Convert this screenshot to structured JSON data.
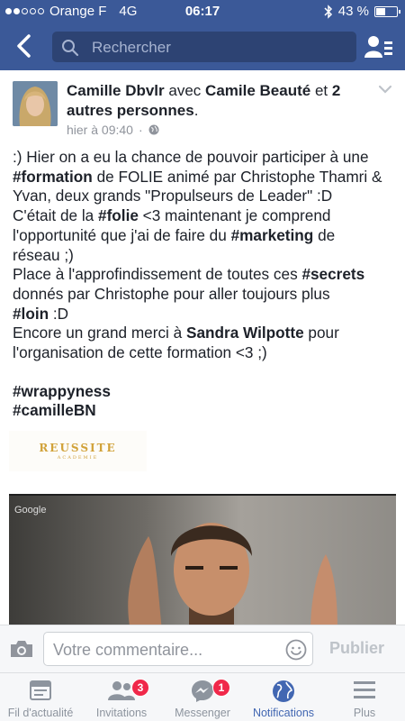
{
  "status_bar": {
    "carrier": "Orange F",
    "network": "4G",
    "time": "06:17",
    "battery": "43 %",
    "battery_level": 0.43
  },
  "navbar": {
    "search_placeholder": "Rechercher",
    "icons": [
      "back-chevron-icon",
      "search-icon",
      "friend-requests-icon"
    ]
  },
  "post": {
    "author": "Camille Dbvlr",
    "with_word": "avec",
    "tagged": "Camile Beauté",
    "and_word": "et",
    "others": "2 autres personnes",
    "period": ".",
    "timestamp": "hier à 09:40",
    "separator": "·",
    "lines": [
      {
        "parts": [
          {
            "t": ":) Hier on a eu la chance de pouvoir participer à une",
            "b": false
          }
        ]
      },
      {
        "parts": [
          {
            "t": "#formation",
            "b": true
          },
          {
            "t": " de FOLIE animé par Christophe Thamri &",
            "b": false
          }
        ]
      },
      {
        "parts": [
          {
            "t": "Yvan, deux grands \"Propulseurs de Leader\" :D",
            "b": false
          }
        ]
      },
      {
        "parts": [
          {
            "t": "C'était de la ",
            "b": false
          },
          {
            "t": "#folie",
            "b": true
          },
          {
            "t": " <3 maintenant je comprend",
            "b": false
          }
        ]
      },
      {
        "parts": [
          {
            "t": "l'opportunité que j'ai de faire du ",
            "b": false
          },
          {
            "t": "#marketing",
            "b": true
          },
          {
            "t": " de",
            "b": false
          }
        ]
      },
      {
        "parts": [
          {
            "t": "réseau ;)",
            "b": false
          }
        ]
      },
      {
        "parts": [
          {
            "t": "Place à l'approfindissement de toutes ces ",
            "b": false
          },
          {
            "t": "#secrets",
            "b": true
          }
        ]
      },
      {
        "parts": [
          {
            "t": "donnés par Christophe pour aller toujours plus",
            "b": false
          }
        ]
      },
      {
        "parts": [
          {
            "t": "#loin",
            "b": true
          },
          {
            "t": " :D",
            "b": false
          }
        ]
      },
      {
        "parts": [
          {
            "t": "Encore un grand merci à ",
            "b": false
          },
          {
            "t": "Sandra Wilpotte",
            "b": true
          },
          {
            "t": " pour",
            "b": false
          }
        ]
      },
      {
        "parts": [
          {
            "t": "l'organisation de cette formation <3 ;)",
            "b": false
          }
        ]
      }
    ],
    "hashtags": [
      "#wrappyness",
      "#camilleBN"
    ],
    "image_logo": {
      "line1": "REUSSITE",
      "line2": "ACADEMIE"
    },
    "video_label": "Google"
  },
  "comment_bar": {
    "placeholder": "Votre commentaire...",
    "publish_label": "Publier"
  },
  "tabs": [
    {
      "label": "Fil d'actualité",
      "icon": "news-feed-icon",
      "badge": null,
      "active": false
    },
    {
      "label": "Invitations",
      "icon": "friends-icon",
      "badge": "3",
      "active": false
    },
    {
      "label": "Messenger",
      "icon": "messenger-icon",
      "badge": "1",
      "active": false
    },
    {
      "label": "Notifications",
      "icon": "globe-icon",
      "badge": null,
      "active": true
    },
    {
      "label": "Plus",
      "icon": "menu-icon",
      "badge": null,
      "active": false
    }
  ],
  "colors": {
    "brand": "#3b5998",
    "active_tab": "#4267b2",
    "badge": "#f0284a",
    "inactive": "#8d949e"
  }
}
